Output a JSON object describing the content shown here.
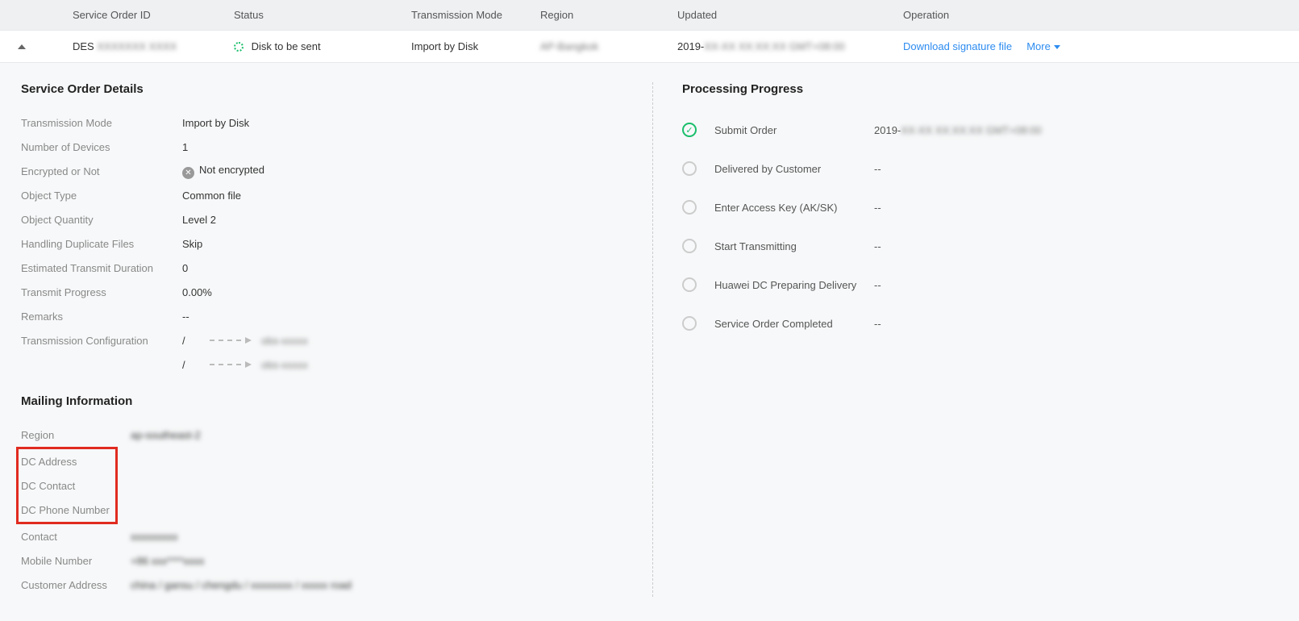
{
  "table": {
    "headers": {
      "id": "Service Order ID",
      "status": "Status",
      "mode": "Transmission Mode",
      "region": "Region",
      "updated": "Updated",
      "operation": "Operation"
    },
    "row": {
      "id_prefix": "DES",
      "id_rest": "XXXXXXX XXXX",
      "status": "Disk to be sent",
      "mode": "Import by Disk",
      "region": "AP-Bangkok",
      "updated_prefix": "2019-",
      "updated_rest": "XX-XX XX:XX:XX GMT+08:00",
      "op_download": "Download signature file",
      "op_more": "More"
    }
  },
  "details": {
    "title": "Service Order Details",
    "transmission_mode_k": "Transmission Mode",
    "transmission_mode_v": "Import by Disk",
    "num_devices_k": "Number of Devices",
    "num_devices_v": "1",
    "encrypted_k": "Encrypted or Not",
    "encrypted_v": "Not encrypted",
    "object_type_k": "Object Type",
    "object_type_v": "Common file",
    "object_qty_k": "Object Quantity",
    "object_qty_v": "Level 2",
    "dup_k": "Handling Duplicate Files",
    "dup_v": "Skip",
    "etd_k": "Estimated Transmit Duration",
    "etd_v": "0",
    "progress_k": "Transmit Progress",
    "progress_v": "0.00%",
    "remarks_k": "Remarks",
    "remarks_v": "--",
    "config_k": "Transmission Configuration",
    "config_src1": "/",
    "config_dst1": "obs-xxxxx",
    "config_src2": "/",
    "config_dst2": "obs-xxxxx"
  },
  "mailing": {
    "title": "Mailing Information",
    "region_k": "Region",
    "region_v": "ap-southeast-2",
    "dc_address_k": "DC Address",
    "dc_address_v": "--",
    "dc_contact_k": "DC Contact",
    "dc_contact_v": "--",
    "dc_phone_k": "DC Phone Number",
    "dc_phone_v": "--",
    "contact_k": "Contact",
    "contact_v": "xxxxxxxxx",
    "mobile_k": "Mobile Number",
    "mobile_v": "+86 xxx****xxxx",
    "cust_addr_k": "Customer Address",
    "cust_addr_v": "china / gansu / chengdu / xxxxxxxx / xxxxx road"
  },
  "progress": {
    "title": "Processing Progress",
    "steps": [
      {
        "label": "Submit Order",
        "value_prefix": "2019-",
        "value_rest": "XX-XX XX:XX:XX GMT+08:00",
        "done": true
      },
      {
        "label": "Delivered by Customer",
        "value": "--",
        "done": false
      },
      {
        "label": "Enter Access Key (AK/SK)",
        "value": "--",
        "done": false
      },
      {
        "label": "Start Transmitting",
        "value": "--",
        "done": false
      },
      {
        "label": "Huawei DC Preparing Delivery",
        "value": "--",
        "done": false
      },
      {
        "label": "Service Order Completed",
        "value": "--",
        "done": false
      }
    ]
  }
}
